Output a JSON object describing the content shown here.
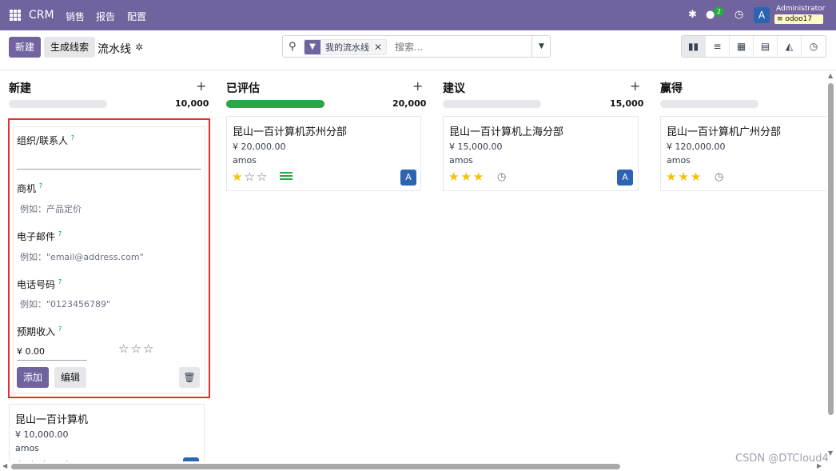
{
  "topbar": {
    "app_name": "CRM",
    "menus": [
      "销售",
      "报告",
      "配置"
    ],
    "chat_count": "2",
    "avatar_letter": "A",
    "user_name": "Administrator",
    "db_name": "odoo17"
  },
  "control": {
    "new_label": "新建",
    "generate_label": "生成线索",
    "breadcrumb": "流水线",
    "facet_label": "我的流水线",
    "search_placeholder": "搜索..."
  },
  "columns": [
    {
      "title": "新建",
      "total": "10,000",
      "progress": 0
    },
    {
      "title": "已评估",
      "total": "20,000",
      "progress": 1
    },
    {
      "title": "建议",
      "total": "15,000",
      "progress": 0
    },
    {
      "title": "赢得",
      "total": "",
      "progress": 0
    }
  ],
  "quick_create": {
    "org_label": "组织/联系人",
    "opp_label": "商机",
    "opp_placeholder": "例如：产品定价",
    "email_label": "电子邮件",
    "email_placeholder": "例如：\"email@address.com\"",
    "phone_label": "电话号码",
    "phone_placeholder": "例如：\"0123456789\"",
    "revenue_label": "预期收入",
    "revenue_value": "¥ 0.00",
    "priority_stars": 0,
    "add_label": "添加",
    "edit_label": "编辑",
    "tooltip_mark": "?"
  },
  "cards": [
    {
      "title": "昆山一百计算机",
      "amount": "¥ 10,000.00",
      "user": "amos",
      "stars": 0,
      "avatar": "A"
    },
    {
      "title": "昆山一百计算机苏州分部",
      "amount": "¥ 20,000.00",
      "user": "amos",
      "stars": 1,
      "avatar": "A"
    },
    {
      "title": "昆山一百计算机上海分部",
      "amount": "¥ 15,000.00",
      "user": "amos",
      "stars": 3,
      "avatar": "A"
    },
    {
      "title": "昆山一百计算机广州分部",
      "amount": "¥ 120,000.00",
      "user": "amos",
      "stars": 3,
      "avatar": ""
    }
  ],
  "watermark": "CSDN @DTCloud4",
  "colors": {
    "brand": "#71639e",
    "progress_fill": "#28a745",
    "star": "#f3c200",
    "avatar": "#2c64b1",
    "highlight_border": "#e03030"
  }
}
